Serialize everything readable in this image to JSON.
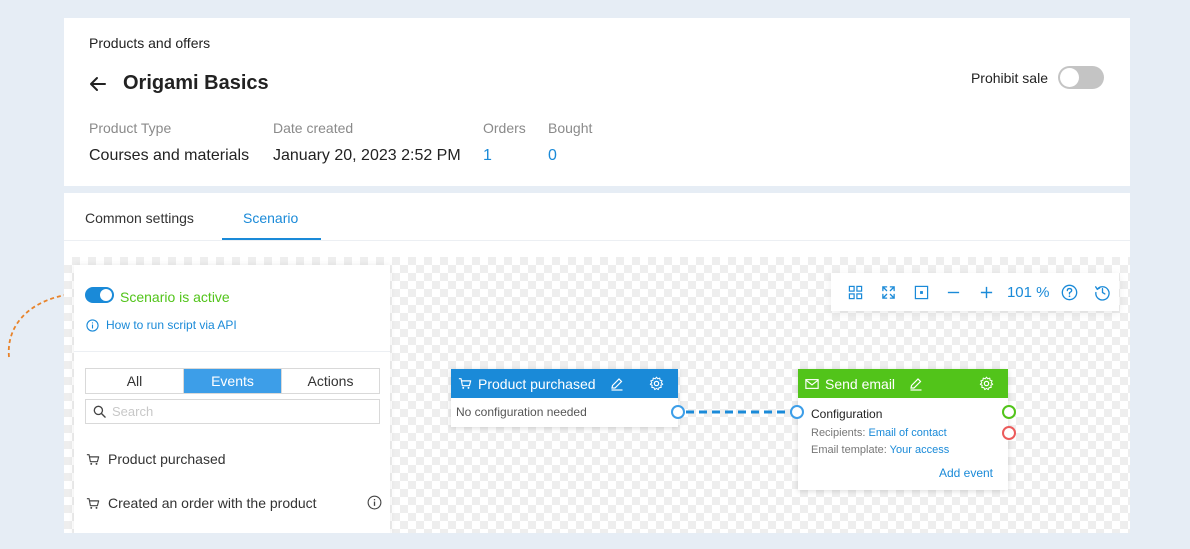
{
  "header": {
    "breadcrumb": "Products and offers",
    "title": "Origami Basics",
    "prohibit_sale_label": "Prohibit sale",
    "prohibit_sale_on": false
  },
  "meta": {
    "product_type": {
      "label": "Product Type",
      "value": "Courses and materials"
    },
    "date_created": {
      "label": "Date created",
      "value": "January 20, 2023 2:52 PM"
    },
    "orders": {
      "label": "Orders",
      "value": "1"
    },
    "bought": {
      "label": "Bought",
      "value": "0"
    }
  },
  "tabs": [
    {
      "label": "Common settings",
      "active": false
    },
    {
      "label": "Scenario",
      "active": true
    }
  ],
  "side_panel": {
    "scenario_status": "Scenario is active",
    "scenario_active": true,
    "api_link": "How to run script via API",
    "filters": [
      {
        "label": "All",
        "active": false
      },
      {
        "label": "Events",
        "active": true
      },
      {
        "label": "Actions",
        "active": false
      }
    ],
    "search_placeholder": "Search",
    "events": [
      {
        "label": "Product purchased"
      },
      {
        "label": "Created an order with the product"
      }
    ]
  },
  "zoom_bar": {
    "zoom_level": "101 %",
    "icons": [
      "grid-icon",
      "fit-screen-icon",
      "select-area-icon",
      "zoom-out-icon",
      "zoom-in-icon",
      "help-icon",
      "history-icon"
    ]
  },
  "nodes": {
    "product_purchased": {
      "title": "Product purchased",
      "body": "No configuration needed",
      "color": "#1a8ad8"
    },
    "send_email": {
      "title": "Send email",
      "color": "#52c41a",
      "config_title": "Configuration",
      "recipients_label": "Recipients:",
      "recipients_value": "Email of contact",
      "template_label": "Email template:",
      "template_value": "Your access",
      "add_event": "Add event"
    }
  },
  "colors": {
    "accent": "#1a8ad8",
    "success": "#52c41a",
    "error": "#ec5b5b",
    "hint": "#e8832a"
  }
}
